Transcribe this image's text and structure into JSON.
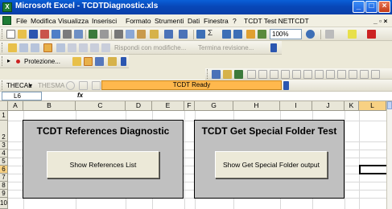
{
  "window": {
    "title": "Microsoft Excel - TCDTDiagnostic.xls"
  },
  "menu": [
    "File",
    "Modifica",
    "Visualizza",
    "Inserisci",
    "Formato",
    "Strumenti",
    "Dati",
    "Finestra",
    "?",
    "TCDT Test NET",
    "TCDT"
  ],
  "toolbar": {
    "zoom": "100%",
    "review_text": "Rispondi con modifiche...",
    "end_review": "Termina revisione...",
    "protection": "Protezione...",
    "thecal": "THECAL",
    "thesma": "THESMA",
    "status_field": "TCDT Ready"
  },
  "formula_bar": {
    "name_box": "L6",
    "fx": "fx",
    "value": ""
  },
  "columns": [
    "A",
    "B",
    "C",
    "D",
    "E",
    "F",
    "G",
    "H",
    "I",
    "J",
    "K",
    "L"
  ],
  "rows": [
    "1",
    "2",
    "3",
    "4",
    "5",
    "6",
    "7",
    "8",
    "9",
    "10"
  ],
  "active_cell": "L6",
  "panels": [
    {
      "title": "TCDT References Diagnostic",
      "button": "Show References List"
    },
    {
      "title": "TCDT Get Special Folder Test",
      "button": "Show Get Special Folder output"
    }
  ],
  "colors": {
    "title_bar": "#0a50c8",
    "panel_bg": "#c0c0c0",
    "status_field": "#ffb84d",
    "excel_green": "#1e7b34"
  }
}
